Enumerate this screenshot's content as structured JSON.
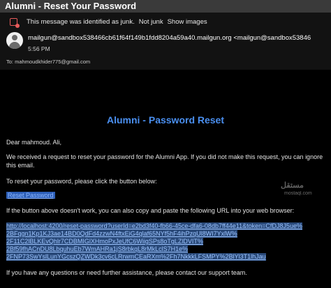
{
  "header": {
    "subject": "Alumni - Reset Your Password"
  },
  "junk_bar": {
    "icon": "junk-shield-icon",
    "message": "This message was identified as junk.",
    "not_junk": "Not junk",
    "show_images": "Show images"
  },
  "sender": {
    "address": "mailgun@sandbox538466cb61f64f149b1fdd8204a59a40.mailgun.org <mailgun@sandbox53846",
    "time": "5:56 PM",
    "to": "To:  mahmoudkhider775@gmail.com"
  },
  "email": {
    "title": "Alumni - Password Reset",
    "greeting": "Dear mahmoud. Ali,",
    "para1_line1": "We received a request to reset your password for the Alumni App. If you did not make this request, you can ignore",
    "para1_line2": "this email.",
    "para2": "To reset your password, please click the button below:",
    "reset_button": "Reset Password",
    "para3": "If the button above doesn't work, you can also copy and paste the following URL into your web browser:",
    "url_lines": [
      "http://localhost:4200/reset-password?userId=e2bd3f40-fb66-45ce-dfa6-08db7ff44e11&token=CfDJ8J5ue%",
      "2BFqgn1Kp1KJ3ae14BD0QdFd4zzwN4ftxEiG4qlaf65NYf5hF4ihPzqUl8WI7YxlW%",
      "2F11C2lBLKEvQhlr7CDBMIGlXHmoPxJeUfC6WiigSPs8oTgLZlDVIT%",
      "2Bf59fhACnDU8LbquhuEb7WmAHRa1jS8rbkqL8rMkLclS7H1e%",
      "2FNP73SwYslLunYGcszQZWDk3cv6cLRrwmCEaRXm%2Fh7NkkkLFSMPY%2BlYl3T1lhJau"
    ],
    "para4": "If you have any questions or need further assistance, please contact our support team."
  },
  "watermark": {
    "logo": "مستقل",
    "text": "mostaql.com"
  }
}
